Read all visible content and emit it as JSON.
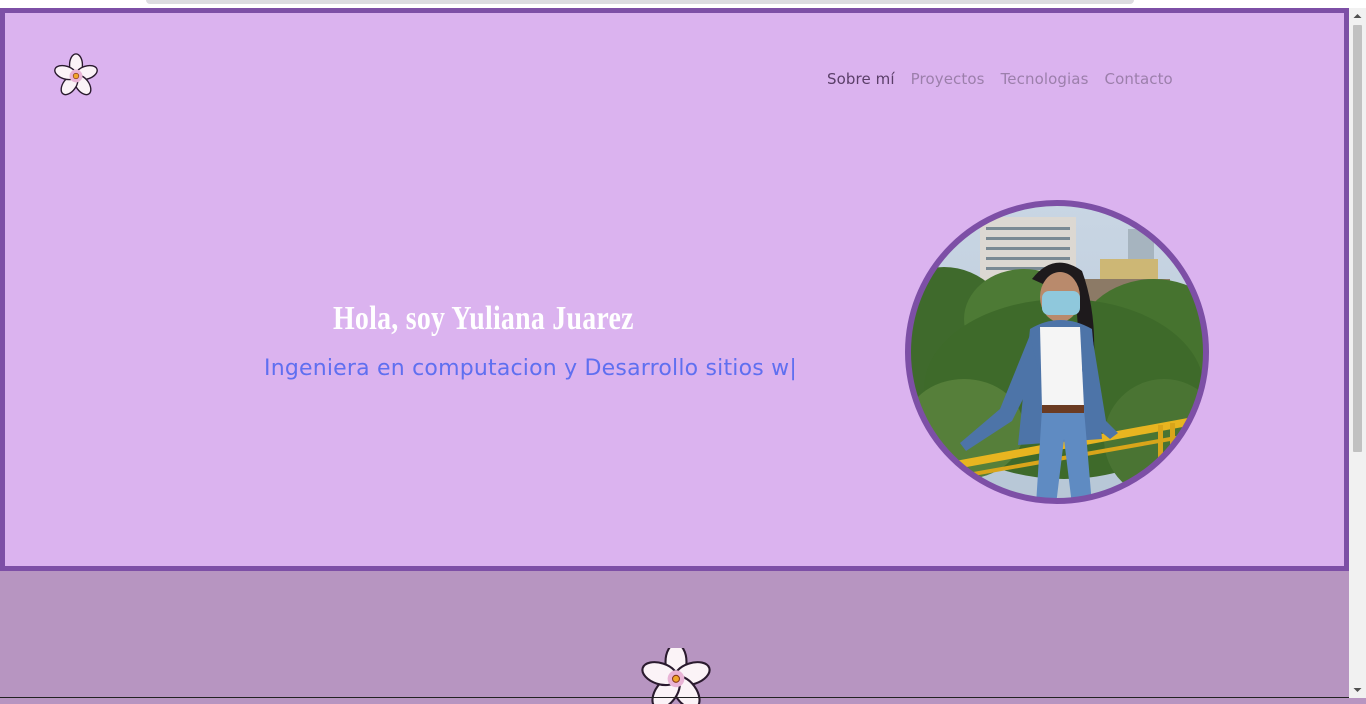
{
  "nav": {
    "items": [
      {
        "label": "Sobre mí",
        "active": true
      },
      {
        "label": "Proyectos",
        "active": false
      },
      {
        "label": "Tecnologias",
        "active": false
      },
      {
        "label": "Contacto",
        "active": false
      }
    ]
  },
  "hero": {
    "greeting": "Hola, soy Yuliana Juarez",
    "subtitle": "Ingeniera en computacion y Desarrollo sitios w|"
  },
  "icons": {
    "logo": "flower-icon",
    "footer_logo": "flower-icon",
    "portrait": "profile-photo"
  },
  "colors": {
    "hero_background": "#dbb3ef",
    "hero_border": "#7d4fa6",
    "page_background": "#b795c1",
    "greeting": "#ffffff",
    "subtitle": "#5f6ff0",
    "nav_active": "#5a3e68",
    "nav_inactive": "#9c7fab"
  }
}
